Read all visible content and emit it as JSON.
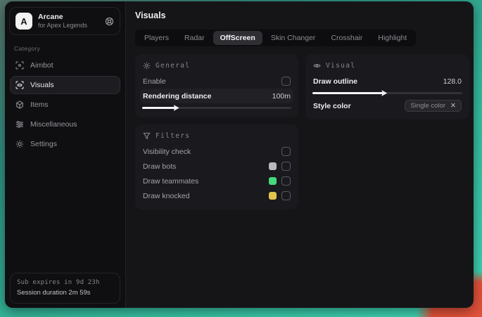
{
  "app": {
    "logo_letter": "A",
    "name": "Arcane",
    "subtitle": "for Apex Legends"
  },
  "sidebar": {
    "category_label": "Category",
    "items": [
      {
        "label": "Aimbot"
      },
      {
        "label": "Visuals"
      },
      {
        "label": "Items"
      },
      {
        "label": "Miscellaneous"
      },
      {
        "label": "Settings"
      }
    ],
    "footer": {
      "sub_expires": "Sub expires in 9d 23h",
      "session_duration": "Session duration 2m 59s"
    }
  },
  "main": {
    "title": "Visuals",
    "active_tab": "OffScreen",
    "tabs": [
      {
        "label": "Players"
      },
      {
        "label": "Radar"
      },
      {
        "label": "OffScreen"
      },
      {
        "label": "Skin Changer"
      },
      {
        "label": "Crosshair"
      },
      {
        "label": "Highlight"
      }
    ]
  },
  "panels": {
    "general": {
      "title": "General",
      "enable_label": "Enable",
      "rendering_label": "Rendering distance",
      "rendering_value": "100m",
      "rendering_fill": "22%"
    },
    "visual": {
      "title": "Visual",
      "outline_label": "Draw outline",
      "outline_value": "128.0",
      "outline_fill": "47%",
      "style_label": "Style color",
      "style_value": "Single color",
      "style_clear": "✕"
    },
    "filters": {
      "title": "Filters",
      "rows": [
        {
          "label": "Visibility check",
          "swatch": null
        },
        {
          "label": "Draw bots",
          "swatch": "#bababd"
        },
        {
          "label": "Draw teammates",
          "swatch": "#45d87c"
        },
        {
          "label": "Draw knocked",
          "swatch": "#e2c350"
        }
      ]
    }
  },
  "colors": {
    "accent_teal": "#35bc9e",
    "accent_red": "#e2523a",
    "window_bg": "#151518",
    "sidebar_bg": "#0f0f12",
    "panel_bg": "#1a1a1e",
    "swatch_bots": "#bababd",
    "swatch_teammates": "#45d87c",
    "swatch_knocked": "#e2c350"
  }
}
